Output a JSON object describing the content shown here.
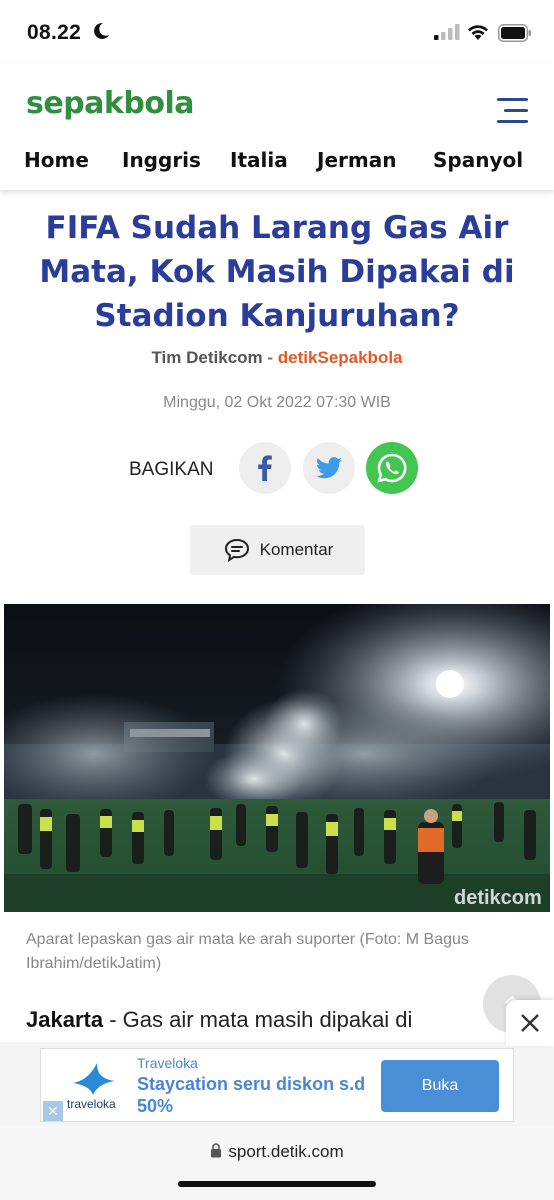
{
  "status_bar": {
    "time": "08.22"
  },
  "header": {
    "logo": "sepakbola",
    "nav": [
      "Home",
      "Inggris",
      "Italia",
      "Jerman",
      "Spanyol"
    ]
  },
  "article": {
    "title": "FIFA Sudah Larang Gas Air Mata, Kok Masih Dipakai di Stadion Kanjuruhan?",
    "author": "Tim Detikcom",
    "separator": "-",
    "source": "detikSepakbola",
    "date": "Minggu, 02 Okt 2022 07:30 WIB",
    "share_label": "BAGIKAN",
    "comment_label": "Komentar",
    "photo_watermark": "detikcom",
    "photo_caption": "Aparat lepaskan gas air mata ke arah suporter (Foto: M Bagus Ibrahim/detikJatim)",
    "lead_location": "Jakarta",
    "lead_text": " - Gas air mata masih dipakai di"
  },
  "ad": {
    "brand": "Traveloka",
    "logo_text": "traveloka",
    "headline": "Staycation seru diskon s.d 50%",
    "cta": "Buka"
  },
  "browser": {
    "url": "sport.detik.com"
  },
  "colors": {
    "title": "#2b3d9b",
    "source": "#e35a28",
    "logo": "#2f8f3f",
    "whatsapp": "#43c552",
    "ad_accent": "#4a8fd6"
  }
}
